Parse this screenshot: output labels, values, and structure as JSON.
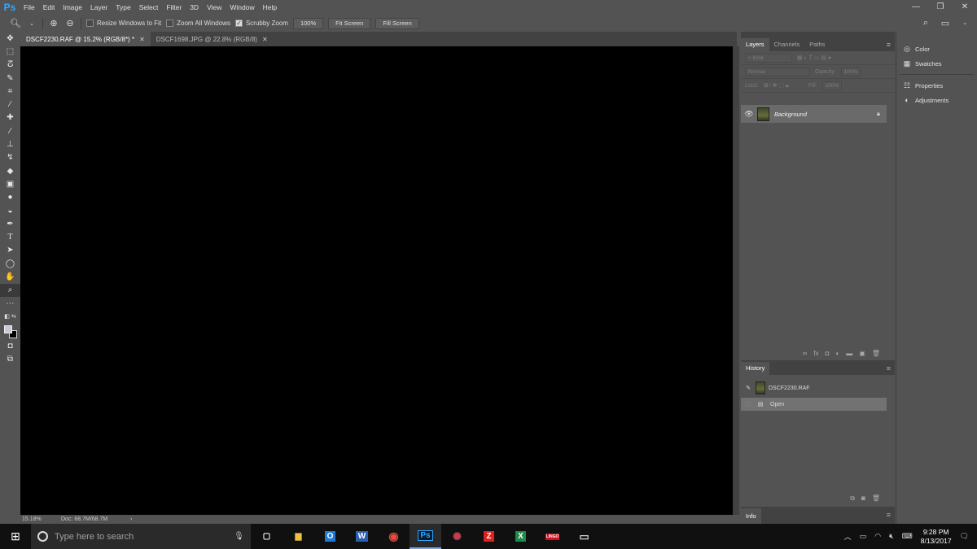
{
  "app": {
    "logo": "Ps"
  },
  "menu": [
    "File",
    "Edit",
    "Image",
    "Layer",
    "Type",
    "Select",
    "Filter",
    "3D",
    "View",
    "Window",
    "Help"
  ],
  "window_controls": [
    "—",
    "❐",
    "✕"
  ],
  "options_bar": {
    "resize_windows_label": "Resize Windows to Fit",
    "zoom_all_label": "Zoom All Windows",
    "scrubby_zoom_label": "Scrubby Zoom",
    "btn_100": "100%",
    "btn_fit": "Fit Screen",
    "btn_fill": "Fill Screen"
  },
  "tabs": [
    {
      "label": "DSCF2230.RAF @ 15.2% (RGB/8*) *",
      "active": true
    },
    {
      "label": "DSCF1698.JPG @ 22.8% (RGB/8)",
      "active": false
    }
  ],
  "status": {
    "zoom": "15.18%",
    "doc": "Doc: 68.7M/68.7M",
    "arrow": "›"
  },
  "layers_panel": {
    "tabs": [
      "Layers",
      "Channels",
      "Paths"
    ],
    "kind": "Kind",
    "blend": "Normal",
    "opacity_label": "Opacity:",
    "opacity_value": "100%",
    "lock_label": "Lock:",
    "fill_label": "Fill:",
    "fill_value": "100%",
    "layer_name": "Background",
    "footer_icons": [
      "∞",
      "fx",
      "◘",
      "◐",
      "▬",
      "▣",
      "🗑"
    ]
  },
  "history_panel": {
    "title": "History",
    "snapshot": "DSCF2230.RAF",
    "step": "Open"
  },
  "info_panel": {
    "title": "Info"
  },
  "dock": {
    "color": "Color",
    "swatches": "Swatches",
    "properties": "Properties",
    "adjustments": "Adjustments"
  },
  "taskbar": {
    "search_placeholder": "Type here to search",
    "time": "9:28 PM",
    "date": "8/13/2017",
    "apps": [
      {
        "label": "▢",
        "color": "#ffffff"
      },
      {
        "label": "▆",
        "color": "#f0c040"
      },
      {
        "label": "O",
        "color": "#1e7ad6"
      },
      {
        "label": "W",
        "color": "#2b5fb4"
      },
      {
        "label": "◉",
        "color": "#e74c3c"
      },
      {
        "label": "Ps",
        "color": "#31a8ff"
      },
      {
        "label": "✺",
        "color": "#c04050"
      },
      {
        "label": "Z",
        "color": "#e02020"
      },
      {
        "label": "X",
        "color": "#1f8a4c"
      },
      {
        "label": "LINGO",
        "color": "#d01020"
      },
      {
        "label": "▭",
        "color": "#cfcfcf"
      }
    ]
  }
}
